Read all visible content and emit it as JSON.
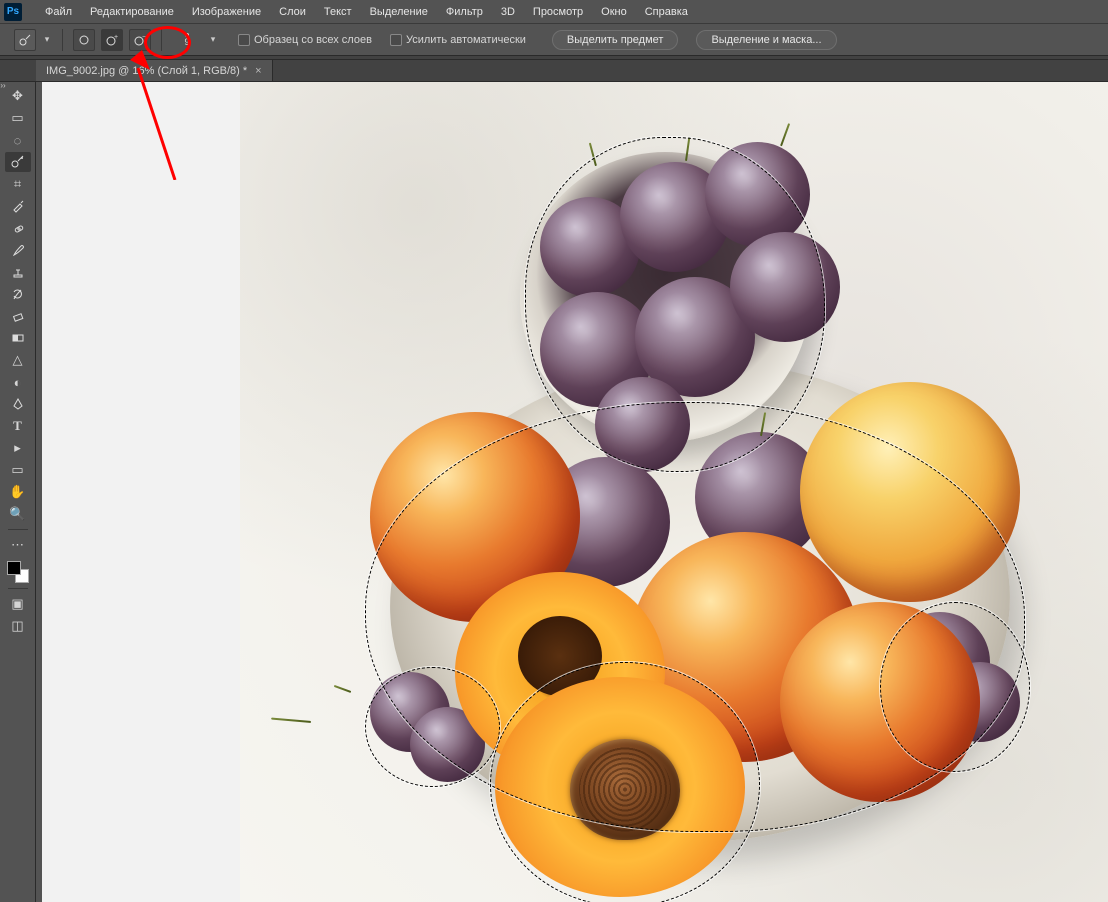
{
  "app": {
    "logo_text": "Ps"
  },
  "menu": {
    "items": [
      "Файл",
      "Редактирование",
      "Изображение",
      "Слои",
      "Текст",
      "Выделение",
      "Фильтр",
      "3D",
      "Просмотр",
      "Окно",
      "Справка"
    ]
  },
  "options": {
    "brush_size": "9",
    "check_sample_all": "Образец со всех слоев",
    "check_enhance": "Усилить автоматически",
    "btn_select_subject": "Выделить предмет",
    "btn_select_mask": "Выделение и маска..."
  },
  "tab": {
    "title": "IMG_9002.jpg @ 16% (Слой 1, RGB/8) *",
    "close": "×"
  },
  "tools": {
    "move": "✥",
    "marquee": "▭",
    "lasso": "◌",
    "quick_select": "✎",
    "crop": "⌗",
    "eyedropper": "✎",
    "healing": "✚",
    "brush": "✎",
    "stamp": "⎌",
    "history": "↺",
    "eraser": "◧",
    "gradient": "▤",
    "smudge": "△",
    "dodge": "◐",
    "pen": "✒",
    "type": "T",
    "path_select": "▸",
    "shape": "▭",
    "hand": "✋",
    "zoom": "🔍",
    "more": "⋯",
    "qmask": "▣",
    "screen": "◫"
  },
  "icons": {
    "dropdown": "▾"
  }
}
